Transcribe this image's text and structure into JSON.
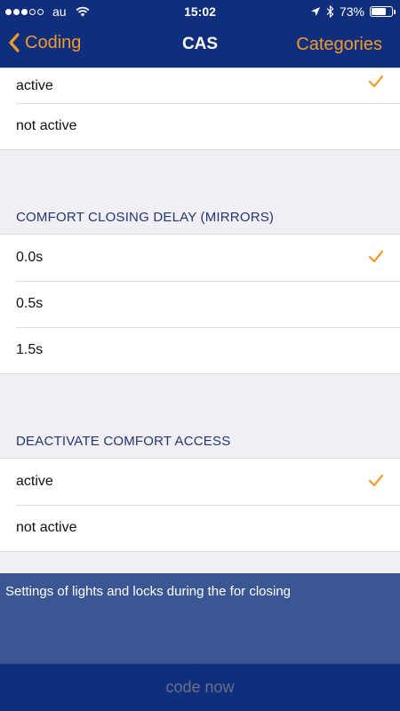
{
  "status_bar": {
    "carrier": "au",
    "time": "15:02",
    "battery": "73%",
    "battery_level": 0.73,
    "signal_bars_filled": 3,
    "signal_bars_total": 5
  },
  "nav": {
    "back_label": "Coding",
    "title": "CAS",
    "right_label": "Categories"
  },
  "sections": [
    {
      "items": [
        {
          "label": "active",
          "checked": true
        },
        {
          "label": "not active",
          "checked": false
        }
      ]
    },
    {
      "header": "COMFORT CLOSING DELAY (MIRRORS)",
      "items": [
        {
          "label": "0.0s",
          "checked": true
        },
        {
          "label": "0.5s",
          "checked": false
        },
        {
          "label": "1.5s",
          "checked": false
        }
      ]
    },
    {
      "header": "DEACTIVATE COMFORT ACCESS",
      "items": [
        {
          "label": "active",
          "checked": true
        },
        {
          "label": "not active",
          "checked": false
        }
      ]
    }
  ],
  "info_text": "Settings of lights and locks during the for closing",
  "code_button_label": "code now",
  "colors": {
    "nav_background": "#0f2f7c",
    "accent_orange": "#f19a2b",
    "info_background": "#3a5794",
    "section_header_text": "#23366f",
    "disabled_button_text": "#6b6f86"
  }
}
